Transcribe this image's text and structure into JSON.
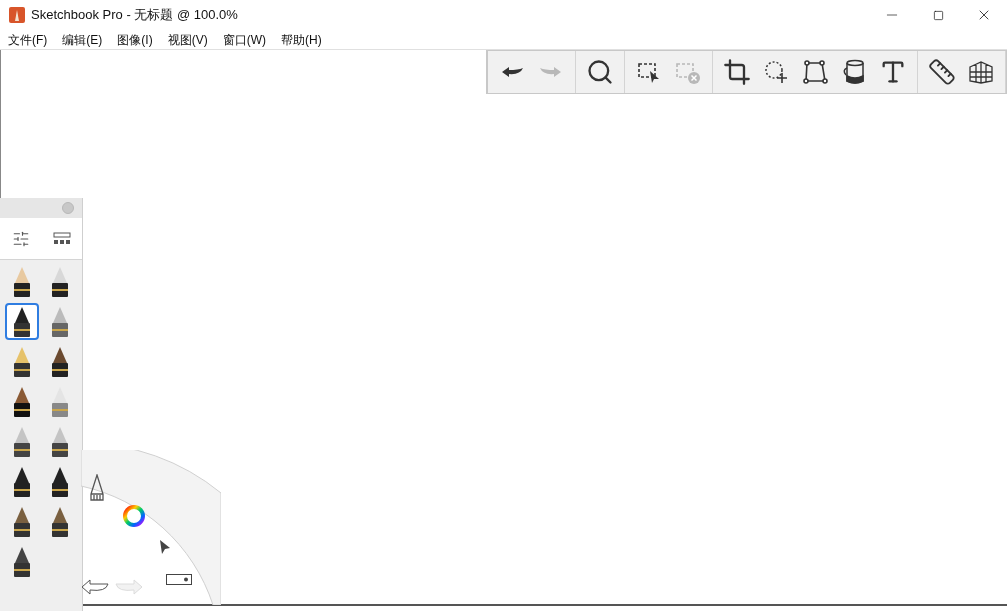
{
  "window": {
    "title": "Sketchbook Pro - 无标题 @ 100.0%"
  },
  "menu": [
    "文件(F)",
    "编辑(E)",
    "图像(I)",
    "视图(V)",
    "窗口(W)",
    "帮助(H)"
  ],
  "toolbar": {
    "groups": [
      [
        {
          "kind": "undo",
          "disabled": false
        },
        {
          "kind": "redo",
          "disabled": true
        }
      ],
      [
        {
          "kind": "zoom",
          "disabled": false
        }
      ],
      [
        {
          "kind": "select",
          "disabled": false
        },
        {
          "kind": "deselect",
          "disabled": true
        }
      ],
      [
        {
          "kind": "crop",
          "disabled": false
        },
        {
          "kind": "lasso",
          "disabled": false
        },
        {
          "kind": "transform",
          "disabled": false
        },
        {
          "kind": "fill",
          "disabled": false
        },
        {
          "kind": "text",
          "disabled": false
        }
      ],
      [
        {
          "kind": "ruler",
          "disabled": false
        },
        {
          "kind": "perspective",
          "disabled": false
        }
      ]
    ]
  },
  "brushes": [
    {
      "kind": "pencil",
      "selected": false
    },
    {
      "kind": "marker",
      "selected": false
    },
    {
      "kind": "inkpen",
      "selected": true
    },
    {
      "kind": "airbrush",
      "selected": false
    },
    {
      "kind": "nib",
      "selected": false
    },
    {
      "kind": "round",
      "selected": false
    },
    {
      "kind": "brush",
      "selected": false
    },
    {
      "kind": "eraser",
      "selected": false
    },
    {
      "kind": "chisel",
      "selected": false
    },
    {
      "kind": "chisel",
      "selected": false
    },
    {
      "kind": "flat",
      "selected": false
    },
    {
      "kind": "flat",
      "selected": false
    },
    {
      "kind": "bristle",
      "selected": false
    },
    {
      "kind": "bristle",
      "selected": false
    },
    {
      "kind": "wide",
      "selected": false
    }
  ],
  "lagoon": {
    "redo_disabled": true
  }
}
